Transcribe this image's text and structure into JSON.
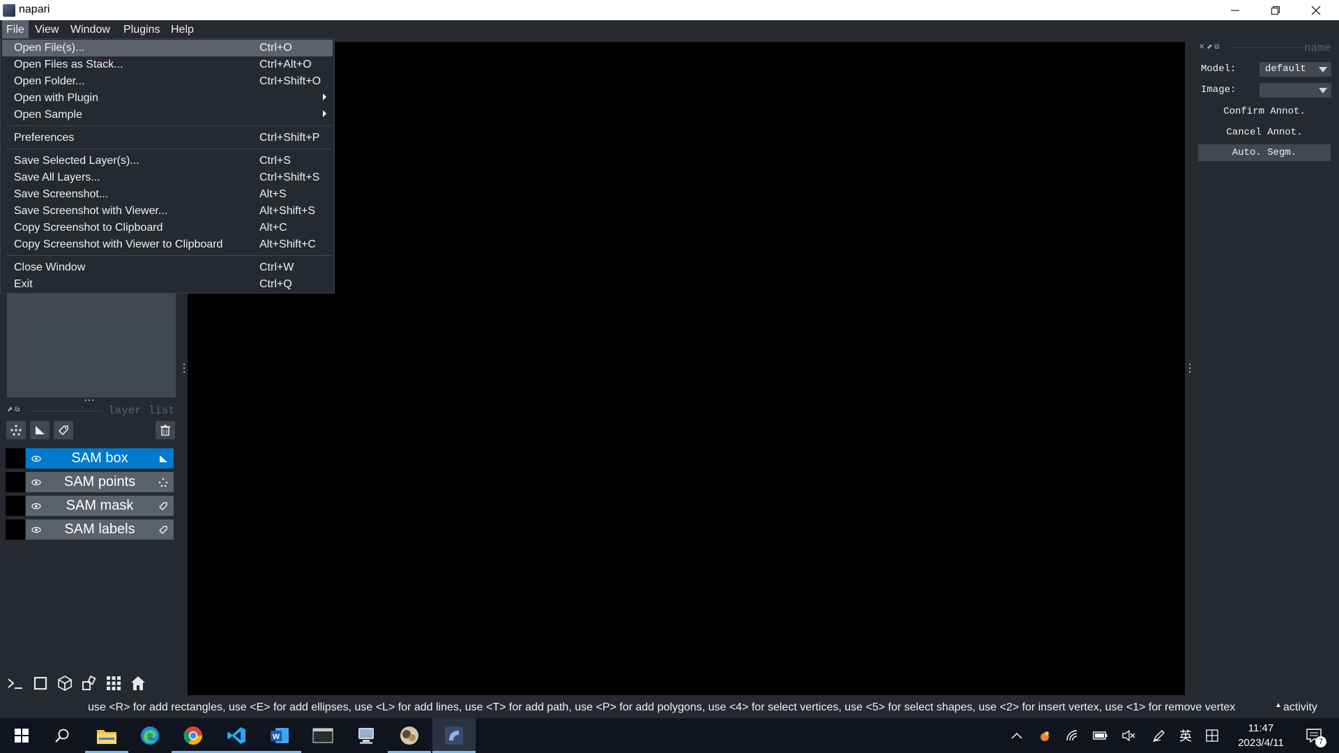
{
  "window": {
    "title": "napari",
    "controls": [
      "minimize-icon",
      "restore-icon",
      "close-icon"
    ]
  },
  "menubar": {
    "items": [
      "File",
      "View",
      "Window",
      "Plugins",
      "Help"
    ]
  },
  "file_menu": {
    "items": [
      {
        "label": "Open File(s)...",
        "shortcut": "Ctrl+O"
      },
      {
        "label": "Open Files as Stack...",
        "shortcut": "Ctrl+Alt+O"
      },
      {
        "label": "Open Folder...",
        "shortcut": "Ctrl+Shift+O"
      },
      {
        "label": "Open with Plugin",
        "shortcut": ""
      },
      {
        "label": "Open Sample",
        "shortcut": ""
      },
      {
        "label": "Preferences",
        "shortcut": "Ctrl+Shift+P"
      },
      {
        "label": "Save Selected Layer(s)...",
        "shortcut": "Ctrl+S"
      },
      {
        "label": "Save All Layers...",
        "shortcut": "Ctrl+Shift+S"
      },
      {
        "label": "Save Screenshot...",
        "shortcut": "Alt+S"
      },
      {
        "label": "Save Screenshot with Viewer...",
        "shortcut": "Alt+Shift+S"
      },
      {
        "label": "Copy Screenshot to Clipboard",
        "shortcut": "Alt+C"
      },
      {
        "label": "Copy Screenshot with Viewer to Clipboard",
        "shortcut": "Alt+Shift+C"
      },
      {
        "label": "Close Window",
        "shortcut": "Ctrl+W"
      },
      {
        "label": "Exit",
        "shortcut": "Ctrl+Q"
      }
    ]
  },
  "layer_list": {
    "title": "layer list",
    "layers": [
      {
        "name": "SAM box",
        "type_icon": "shapes-icon",
        "selected": true
      },
      {
        "name": "SAM points",
        "type_icon": "points-icon",
        "selected": false
      },
      {
        "name": "SAM mask",
        "type_icon": "labels-icon",
        "selected": false
      },
      {
        "name": "SAM labels",
        "type_icon": "labels-icon",
        "selected": false
      }
    ]
  },
  "plugin_panel": {
    "title": "name",
    "model_label": "Model:",
    "model_value": "default",
    "image_label": "Image:",
    "image_value": "",
    "confirm_label": "Confirm Annot.",
    "cancel_label": "Cancel Annot.",
    "auto_label": "Auto. Segm."
  },
  "status": {
    "text": "use <R> for add rectangles, use <E> for add ellipses, use <L> for add lines, use <T> for add path, use <P> for add polygons, use <4> for select vertices, use <5> for select shapes, use <2> for insert vertex, use <1> for remove vertex",
    "activity": "activity"
  },
  "taskbar": {
    "time": "11:47",
    "date": "2023/4/11",
    "ime": "英",
    "notifications": "7"
  },
  "colors": {
    "background": "#262930",
    "selected_layer": "#007acc",
    "highlight": "#5a626c"
  }
}
